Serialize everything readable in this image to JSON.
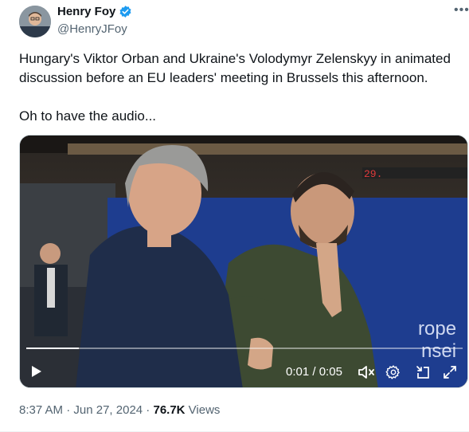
{
  "author": {
    "display_name": "Henry Foy",
    "handle": "@HenryJFoy",
    "verified": true
  },
  "tweet": {
    "text": "Hungary's Viktor Orban and Ukraine's Volodymyr Zelenskyy in animated discussion before an EU leaders' meeting in Brussels this afternoon.\n\nOh to have the audio..."
  },
  "video": {
    "current_time": "0:01",
    "separator": " / ",
    "duration": "0:05",
    "progress_fraction": 0.12,
    "backdrop_text": "rope\nnsei",
    "ticker_text": "29."
  },
  "meta": {
    "time": "8:37 AM",
    "separator": " · ",
    "date": "Jun 27, 2024",
    "separator2": " · ",
    "views_count": "76.7K",
    "views_label": " Views"
  },
  "icons": {
    "more": "more-icon",
    "verified": "verified-badge-icon",
    "play": "play-icon",
    "volume": "volume-icon",
    "settings": "gear-icon",
    "pip": "picture-in-picture-icon",
    "fullscreen": "fullscreen-icon"
  },
  "colors": {
    "verified_blue": "#1d9bf0",
    "text_primary": "#0f1419",
    "text_secondary": "#536471",
    "eu_blue": "#1e3d8f"
  }
}
